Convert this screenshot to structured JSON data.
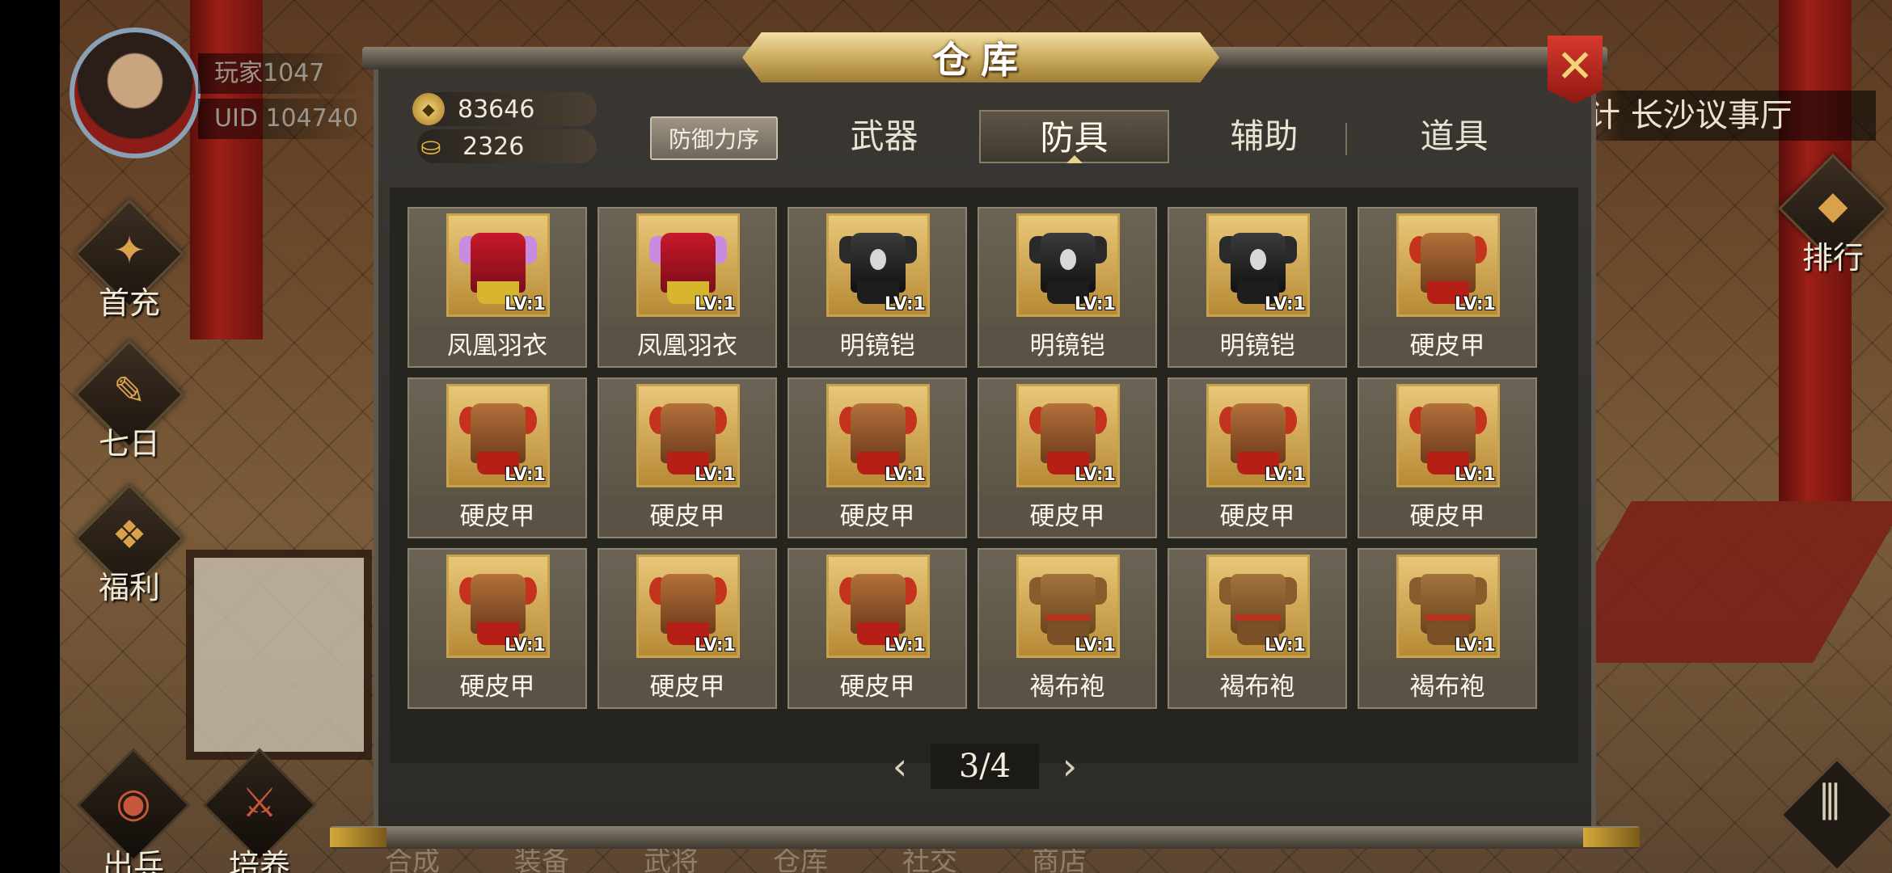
{
  "player": {
    "name": "玩家1047",
    "uid": "UID  104740"
  },
  "side_menu": [
    {
      "label": "首充",
      "icon": "gift-icon"
    },
    {
      "label": "七日",
      "icon": "scroll-icon"
    },
    {
      "label": "福利",
      "icon": "treasure-icon"
    }
  ],
  "rank": {
    "label": "排行",
    "icon": "ranking-icon"
  },
  "location": "计 长沙议事厅",
  "bottom_buttons": [
    {
      "label": "出兵",
      "icon": "drum-icon"
    },
    {
      "label": "培养",
      "icon": "sword-icon"
    }
  ],
  "bottom_nav": [
    "合成",
    "装备",
    "武将",
    "仓库",
    "社交",
    "商店"
  ],
  "dialog": {
    "title": "仓库",
    "currency": {
      "gold": "83646",
      "ingot": "2326"
    },
    "sort_label": "防御力序",
    "tabs": [
      "武器",
      "防具",
      "辅助",
      "道具"
    ],
    "active_tab": "防具",
    "pagination": {
      "current": "3/4",
      "prev": "‹",
      "next": "›"
    },
    "items": [
      {
        "name": "凤凰羽衣",
        "level": "LV:1",
        "type": "phoenix"
      },
      {
        "name": "凤凰羽衣",
        "level": "LV:1",
        "type": "phoenix"
      },
      {
        "name": "明镜铠",
        "level": "LV:1",
        "type": "mirror"
      },
      {
        "name": "明镜铠",
        "level": "LV:1",
        "type": "mirror"
      },
      {
        "name": "明镜铠",
        "level": "LV:1",
        "type": "mirror"
      },
      {
        "name": "硬皮甲",
        "level": "LV:1",
        "type": "leather"
      },
      {
        "name": "硬皮甲",
        "level": "LV:1",
        "type": "leather"
      },
      {
        "name": "硬皮甲",
        "level": "LV:1",
        "type": "leather"
      },
      {
        "name": "硬皮甲",
        "level": "LV:1",
        "type": "leather"
      },
      {
        "name": "硬皮甲",
        "level": "LV:1",
        "type": "leather"
      },
      {
        "name": "硬皮甲",
        "level": "LV:1",
        "type": "leather"
      },
      {
        "name": "硬皮甲",
        "level": "LV:1",
        "type": "leather"
      },
      {
        "name": "硬皮甲",
        "level": "LV:1",
        "type": "leather"
      },
      {
        "name": "硬皮甲",
        "level": "LV:1",
        "type": "leather"
      },
      {
        "name": "硬皮甲",
        "level": "LV:1",
        "type": "leather"
      },
      {
        "name": "褐布袍",
        "level": "LV:1",
        "type": "robe"
      },
      {
        "name": "褐布袍",
        "level": "LV:1",
        "type": "robe"
      },
      {
        "name": "褐布袍",
        "level": "LV:1",
        "type": "robe"
      }
    ]
  },
  "colors": {
    "gold_accent": "#c9a75b",
    "close_red": "#d8392c",
    "panel": "#3a3733"
  }
}
